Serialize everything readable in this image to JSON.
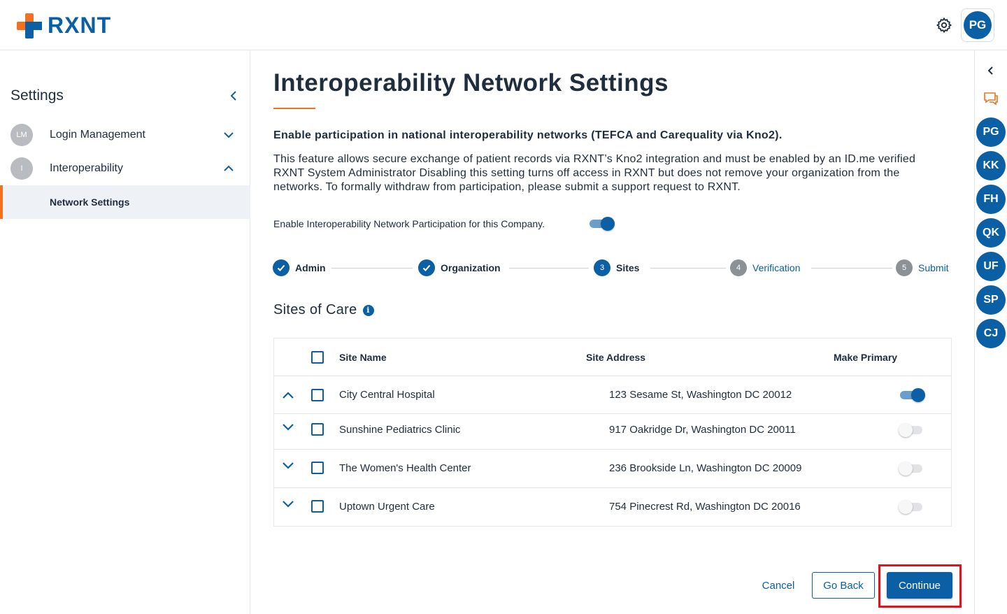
{
  "brand": {
    "logo_text": "RXNT"
  },
  "header": {
    "settings_icon": "gear-icon",
    "user_initials": "PG"
  },
  "sidebar": {
    "title": "Settings",
    "items": [
      {
        "initials": "LM",
        "label": "Login Management",
        "expanded": false
      },
      {
        "initials": "I",
        "label": "Interoperability",
        "expanded": true
      }
    ],
    "sub_item": "Network Settings"
  },
  "rail": {
    "users": [
      "PG",
      "KK",
      "FH",
      "QK",
      "UF",
      "SP",
      "CJ"
    ]
  },
  "main": {
    "title": "Interoperability Network Settings",
    "subheading": "Enable participation in national interoperability networks (TEFCA and Carequality via Kno2).",
    "description": "This feature allows secure exchange of patient records via RXNT’s Kno2 integration and must be enabled by an ID.me verified RXNT System Administrator Disabling this setting turns off access in RXNT but does not remove your organization from the networks. To formally withdraw from participation, please submit a support request to RXNT.",
    "enable_label": "Enable Interoperability Network Participation for this Company.",
    "enable_on": true
  },
  "stepper": {
    "steps": [
      {
        "num": "1",
        "label": "Admin",
        "state": "done"
      },
      {
        "num": "2",
        "label": "Organization",
        "state": "done"
      },
      {
        "num": "3",
        "label": "Sites",
        "state": "current"
      },
      {
        "num": "4",
        "label": "Verification",
        "state": "todo"
      },
      {
        "num": "5",
        "label": "Submit",
        "state": "todo"
      }
    ]
  },
  "sites": {
    "title": "Sites of Care",
    "columns": {
      "name": "Site Name",
      "address": "Site Address",
      "primary": "Make Primary"
    },
    "rows": [
      {
        "name": "City Central Hospital",
        "address": "123 Sesame St, Washington DC 20012",
        "primary": true,
        "expanded": true
      },
      {
        "name": "Sunshine Pediatrics Clinic",
        "address": "917 Oakridge Dr, Washington DC 20011",
        "primary": false,
        "expanded": false
      },
      {
        "name": "The Women's Health Center",
        "address": "236 Brookside Ln, Washington DC 20009",
        "primary": false,
        "expanded": false
      },
      {
        "name": "Uptown Urgent Care",
        "address": "754 Pinecrest Rd, Washington DC 20016",
        "primary": false,
        "expanded": false
      }
    ]
  },
  "actions": {
    "cancel": "Cancel",
    "back": "Go Back",
    "continue": "Continue"
  },
  "colors": {
    "brand_blue": "#0b5fa5",
    "brand_orange": "#f37021",
    "highlight": "#e0141e"
  }
}
